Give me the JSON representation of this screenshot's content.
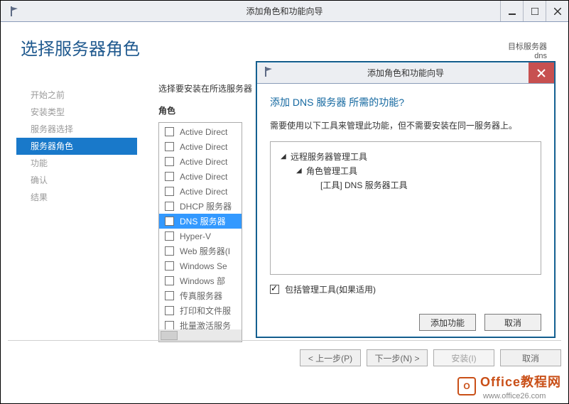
{
  "window": {
    "title": "添加角色和功能向导",
    "min_label": "minimize-icon",
    "max_label": "restore-icon",
    "close_label": "close-icon"
  },
  "wizard": {
    "heading": "选择服务器角色",
    "dest_label": "目标服务器",
    "dest_value": "dns",
    "sidebar": {
      "items": [
        {
          "label": "开始之前",
          "id": "before-you-begin"
        },
        {
          "label": "安装类型",
          "id": "installation-type"
        },
        {
          "label": "服务器选择",
          "id": "server-selection"
        },
        {
          "label": "服务器角色",
          "id": "server-roles",
          "active": true
        },
        {
          "label": "功能",
          "id": "features"
        },
        {
          "label": "确认",
          "id": "confirmation"
        },
        {
          "label": "结果",
          "id": "results"
        }
      ]
    },
    "instruction": "选择要安装在所选服务器",
    "roles_label": "角色",
    "roles": [
      {
        "label": "Active Direct"
      },
      {
        "label": "Active Direct"
      },
      {
        "label": "Active Direct"
      },
      {
        "label": "Active Direct"
      },
      {
        "label": "Active Direct"
      },
      {
        "label": "DHCP 服务器"
      },
      {
        "label": "DNS 服务器",
        "selected": true
      },
      {
        "label": "Hyper-V"
      },
      {
        "label": "Web 服务器(I"
      },
      {
        "label": "Windows Se"
      },
      {
        "label": "Windows 部"
      },
      {
        "label": "传真服务器"
      },
      {
        "label": "打印和文件服"
      },
      {
        "label": "批量激活服务"
      }
    ],
    "footer": {
      "prev": "< 上一步(P)",
      "next": "下一步(N) >",
      "install": "安装(I)",
      "cancel": "取消"
    }
  },
  "dialog": {
    "title": "添加角色和功能向导",
    "heading": "添加 DNS 服务器 所需的功能?",
    "text": "需要使用以下工具来管理此功能，但不需要安装在同一服务器上。",
    "tree": {
      "lvl1": "远程服务器管理工具",
      "lvl2": "角色管理工具",
      "lvl3": "[工具] DNS 服务器工具"
    },
    "include_label": "包括管理工具(如果适用)",
    "include_checked": true,
    "add_button": "添加功能",
    "cancel_button": "取消"
  },
  "watermark": {
    "brand": "Office教程网",
    "url": "www.office26.com"
  }
}
